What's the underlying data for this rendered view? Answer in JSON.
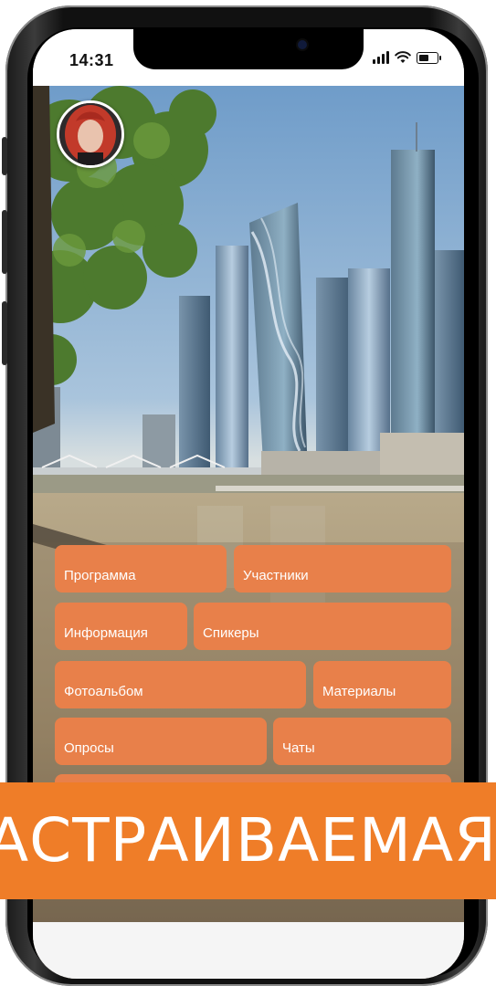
{
  "status_bar": {
    "time": "14:31",
    "icons": [
      "signal-icon",
      "wifi-icon",
      "battery-icon"
    ]
  },
  "avatar": {
    "icon": "avatar-photo"
  },
  "menu": {
    "items": [
      {
        "label": "Программа"
      },
      {
        "label": "Участники"
      },
      {
        "label": "Информация"
      },
      {
        "label": "Спикеры"
      },
      {
        "label": "Фотоальбом"
      },
      {
        "label": "Материалы"
      },
      {
        "label": "Опросы"
      },
      {
        "label": "Чаты"
      }
    ]
  },
  "banner": {
    "text": "АСТРАИВАЕМАЯ"
  },
  "colors": {
    "menu_button": "#e8804a",
    "banner": "#ef7d28",
    "text": "#ffffff"
  }
}
